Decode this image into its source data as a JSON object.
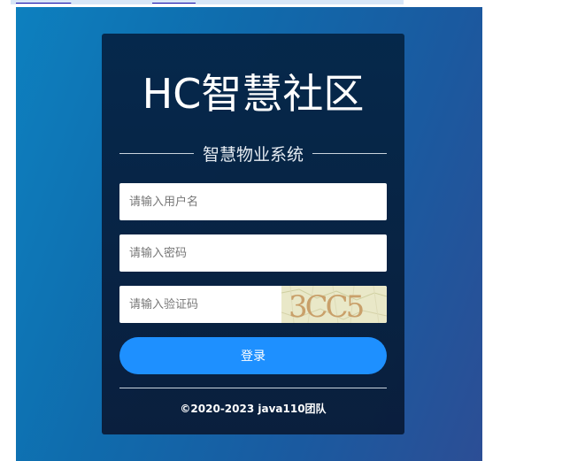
{
  "login": {
    "title": "HC智慧社区",
    "subtitle": "智慧物业系统",
    "username_placeholder": "请输入用户名",
    "password_placeholder": "请输入密码",
    "captcha_placeholder": "请输入验证码",
    "captcha_text": "3CC5",
    "login_label": "登录",
    "footer": "©2020-2023 java110团队"
  },
  "colors": {
    "background_start": "#0d80bf",
    "background_end": "#2c4e95",
    "card": "#0a2a4e",
    "button": "#1e90ff"
  }
}
